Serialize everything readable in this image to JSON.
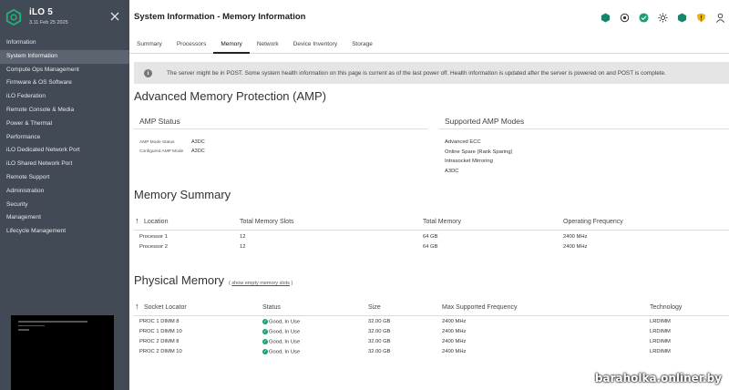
{
  "brand": {
    "title": "iLO 5",
    "version": "3.11 Feb 25 2025"
  },
  "sidebar": {
    "items": [
      {
        "label": "Information"
      },
      {
        "label": "System Information"
      },
      {
        "label": "Compute Ops Management"
      },
      {
        "label": "Firmware & OS Software"
      },
      {
        "label": "iLO Federation"
      },
      {
        "label": "Remote Console & Media"
      },
      {
        "label": "Power & Thermal"
      },
      {
        "label": "Performance"
      },
      {
        "label": "iLO Dedicated Network Port"
      },
      {
        "label": "iLO Shared Network Port"
      },
      {
        "label": "Remote Support"
      },
      {
        "label": "Administration"
      },
      {
        "label": "Security"
      },
      {
        "label": "Management"
      },
      {
        "label": "Lifecycle Management"
      }
    ],
    "active_index": 1
  },
  "header": {
    "title": "System Information - Memory Information",
    "icons": [
      "health-icon",
      "power-icon",
      "status-ok-icon",
      "uid-icon",
      "security-icon",
      "shield-warning-icon",
      "user-icon"
    ],
    "colors": {
      "health": "#16866a",
      "ok": "#16a36e",
      "warning": "#e8b30b"
    }
  },
  "tabs": [
    {
      "label": "Summary"
    },
    {
      "label": "Processors"
    },
    {
      "label": "Memory"
    },
    {
      "label": "Network"
    },
    {
      "label": "Device Inventory"
    },
    {
      "label": "Storage"
    }
  ],
  "active_tab": "Memory",
  "banner": {
    "icon": "info-icon",
    "text": "The server might be in POST. Some system health information on this page is current as of the last power off. Health information is updated after the server is powered on and POST is complete."
  },
  "amp": {
    "title": "Advanced Memory Protection (AMP)",
    "status_title": "AMP Status",
    "mode_status_label": "AMP Mode Status",
    "mode_status_value": "A3DC",
    "configured_label": "Configured AMP Mode",
    "configured_value": "A3DC",
    "supported_title": "Supported AMP Modes",
    "supported_modes": [
      "Advanced ECC",
      "Online Spare (Rank Sparing)",
      "Intrasocket Mirroring",
      "A3DC"
    ]
  },
  "memory_summary": {
    "title": "Memory Summary",
    "columns": [
      "Location",
      "Total Memory Slots",
      "Total Memory",
      "Operating Frequency"
    ],
    "rows": [
      [
        "Processor 1",
        "12",
        "64 GB",
        "2400 MHz"
      ],
      [
        "Processor 2",
        "12",
        "64 GB",
        "2400 MHz"
      ]
    ]
  },
  "physical_memory": {
    "title": "Physical Memory",
    "show_empty_prefix": "(",
    "show_empty_link": "show empty memory slots",
    "show_empty_suffix": ")",
    "columns": [
      "Socket Locator",
      "Status",
      "Size",
      "Max Supported Frequency",
      "Technology"
    ],
    "rows": [
      [
        "PROC 1 DIMM 8",
        "Good, In Use",
        "32.00 GB",
        "2400 MHz",
        "LRDIMM"
      ],
      [
        "PROC 1 DIMM 10",
        "Good, In Use",
        "32.00 GB",
        "2400 MHz",
        "LRDIMM"
      ],
      [
        "PROC 2 DIMM 8",
        "Good, In Use",
        "32.00 GB",
        "2400 MHz",
        "LRDIMM"
      ],
      [
        "PROC 2 DIMM 10",
        "Good, In Use",
        "32.00 GB",
        "2400 MHz",
        "LRDIMM"
      ]
    ]
  },
  "watermark": "baraholka.onliner.by"
}
